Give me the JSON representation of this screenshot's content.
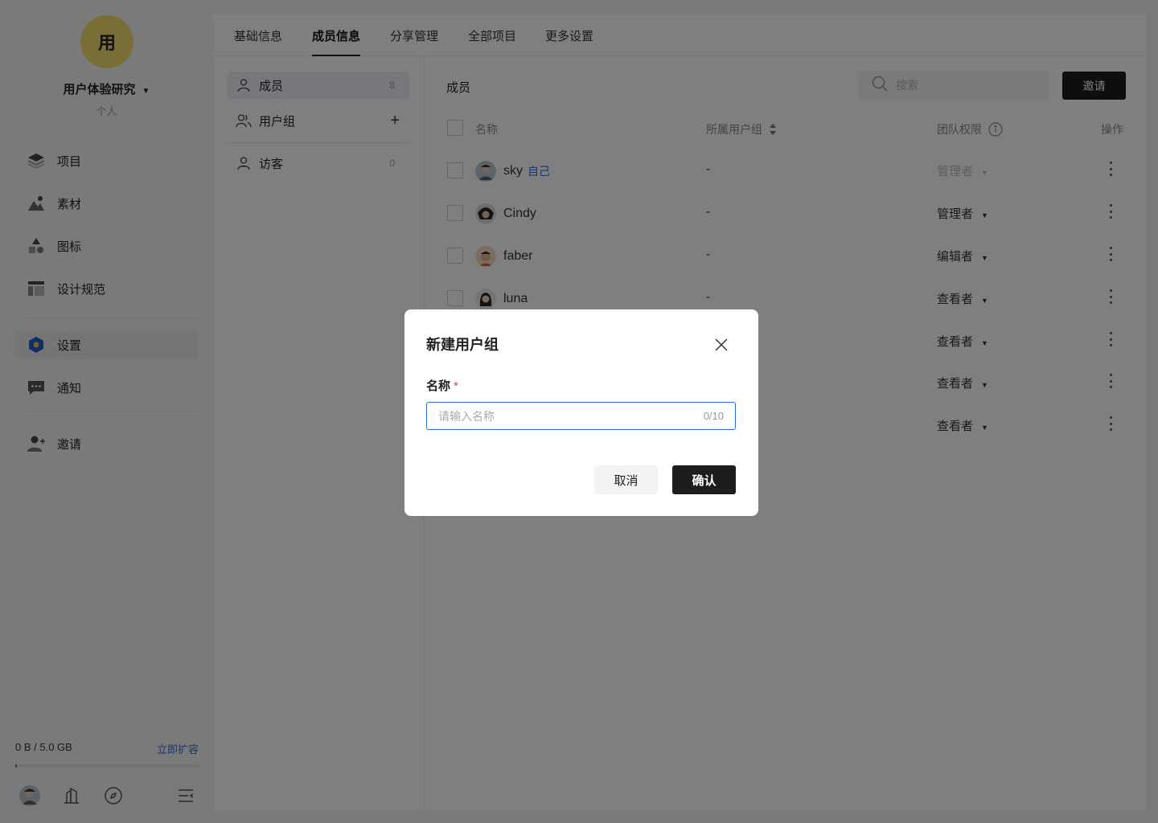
{
  "sidebar": {
    "avatar_char": "用",
    "team_name": "用户体验研究",
    "team_type": "个人",
    "nav": [
      {
        "label": "项目",
        "icon": "layers-icon"
      },
      {
        "label": "素材",
        "icon": "image-icon"
      },
      {
        "label": "图标",
        "icon": "shapes-icon"
      },
      {
        "label": "设计规范",
        "icon": "layout-icon"
      },
      {
        "label": "设置",
        "icon": "hexagon-settings-icon",
        "active": true
      },
      {
        "label": "通知",
        "icon": "chat-icon"
      },
      {
        "label": "邀请",
        "icon": "add-user-icon"
      }
    ],
    "storage": {
      "used": "0 B / 5.0 GB",
      "expand_label": "立即扩容",
      "used_fraction": 0.005
    }
  },
  "tabs": [
    {
      "label": "基础信息"
    },
    {
      "label": "成员信息",
      "active": true
    },
    {
      "label": "分享管理"
    },
    {
      "label": "全部项目"
    },
    {
      "label": "更多设置"
    }
  ],
  "subnav": [
    {
      "label": "成员",
      "count": "8",
      "active": true
    },
    {
      "label": "用户组",
      "action": "+"
    },
    {
      "label": "访客",
      "count": "0"
    }
  ],
  "content": {
    "title": "成员",
    "search_placeholder": "搜索",
    "invite_label": "邀请",
    "columns": {
      "name": "名称",
      "group": "所属用户组",
      "role": "团队权限",
      "actions": "操作"
    },
    "members": [
      {
        "name": "sky",
        "self_tag": "自己",
        "group": "-",
        "role": "管理者",
        "disabled": true
      },
      {
        "name": "Cindy",
        "self_tag": "",
        "group": "-",
        "role": "管理者"
      },
      {
        "name": "faber",
        "self_tag": "",
        "group": "-",
        "role": "编辑者"
      },
      {
        "name": "luna",
        "self_tag": "",
        "group": "-",
        "role": "查看者"
      },
      {
        "name": "",
        "self_tag": "",
        "group": "",
        "role": "查看者"
      },
      {
        "name": "",
        "self_tag": "",
        "group": "",
        "role": "查看者"
      },
      {
        "name": "",
        "self_tag": "",
        "group": "",
        "role": "查看者"
      }
    ]
  },
  "dialog": {
    "title": "新建用户组",
    "field_label": "名称",
    "required_mark": "*",
    "placeholder": "请输入名称",
    "counter": "0/10",
    "cancel_label": "取消",
    "confirm_label": "确认"
  }
}
